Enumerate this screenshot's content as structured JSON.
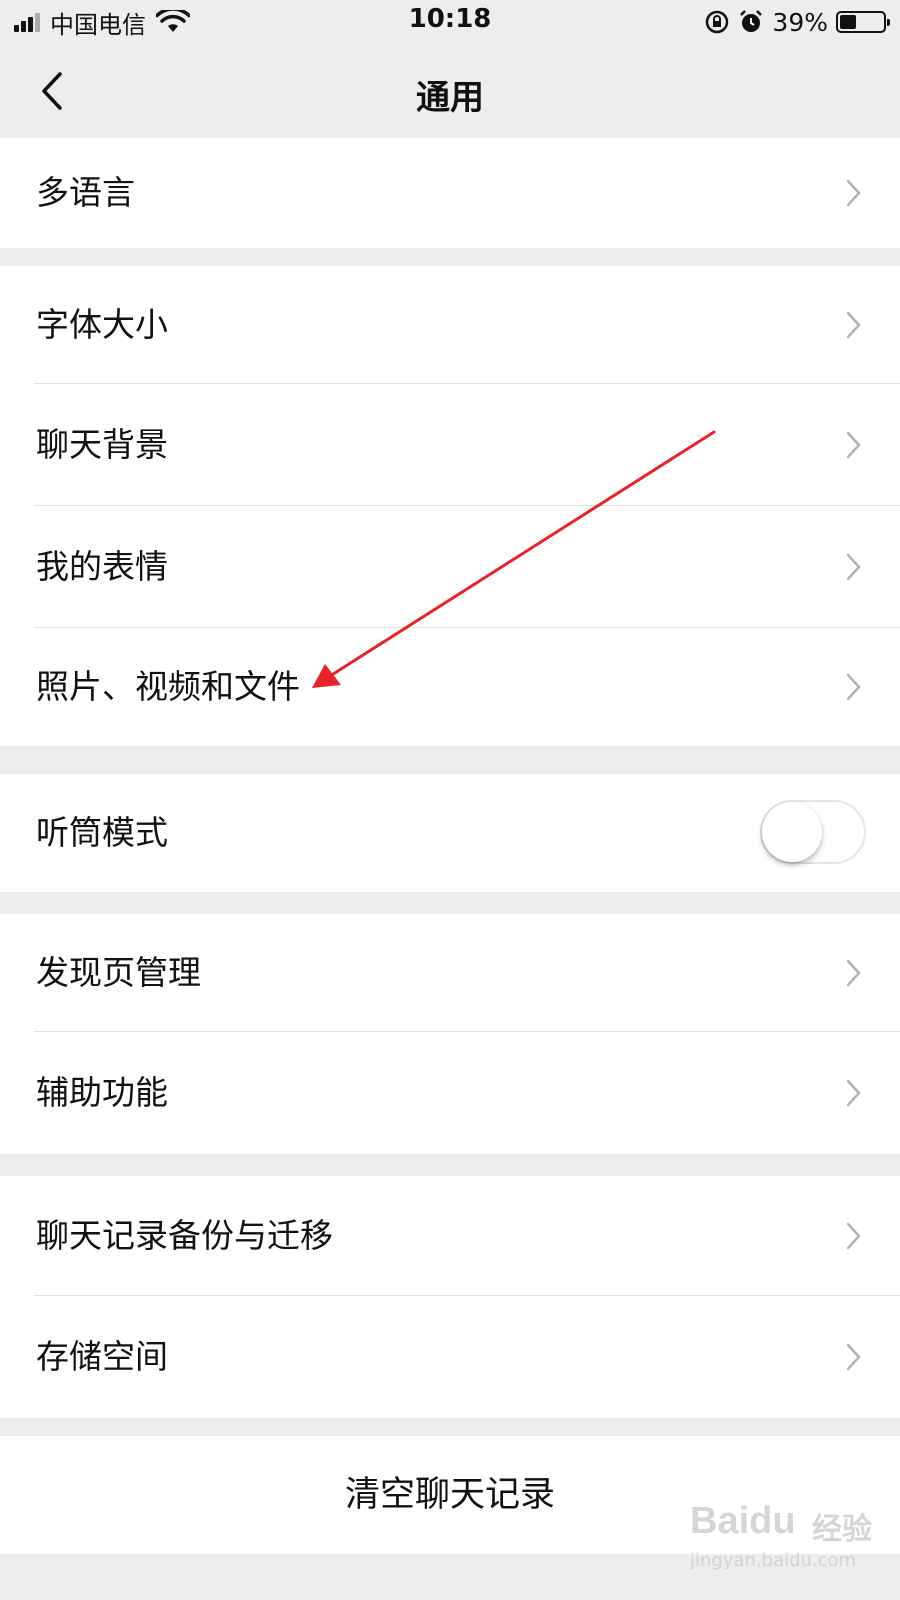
{
  "status_bar": {
    "carrier": "中国电信",
    "time": "10:18",
    "battery": "39%",
    "battery_level": 0.39,
    "icons": [
      "signal-icon",
      "wifi-icon",
      "rotation-lock-icon",
      "alarm-icon",
      "battery-icon"
    ]
  },
  "nav": {
    "title": "通用",
    "back_icon": "chevron-left-icon"
  },
  "groups": {
    "language": {
      "items": [
        "多语言"
      ]
    },
    "display": {
      "items": [
        "字体大小",
        "聊天背景",
        "我的表情",
        "照片、视频和文件"
      ]
    },
    "earpiece": {
      "label": "听筒模式",
      "enabled": false
    },
    "discover": {
      "items": [
        "发现页管理",
        "辅助功能"
      ]
    },
    "storage": {
      "items": [
        "聊天记录备份与迁移",
        "存储空间"
      ]
    }
  },
  "clear_button": {
    "label": "清空聊天记录"
  },
  "annotation": {
    "arrow_color": "#e8232a",
    "points_to": "照片、视频和文件"
  },
  "watermark": {
    "logo": "Baidu",
    "jingyan": "经验",
    "url": "jingyan.baidu.com"
  },
  "colors": {
    "background": "#ededed",
    "row": "#ffffff",
    "chevron": "#b2b2b2",
    "arrow": "#e8232a"
  }
}
